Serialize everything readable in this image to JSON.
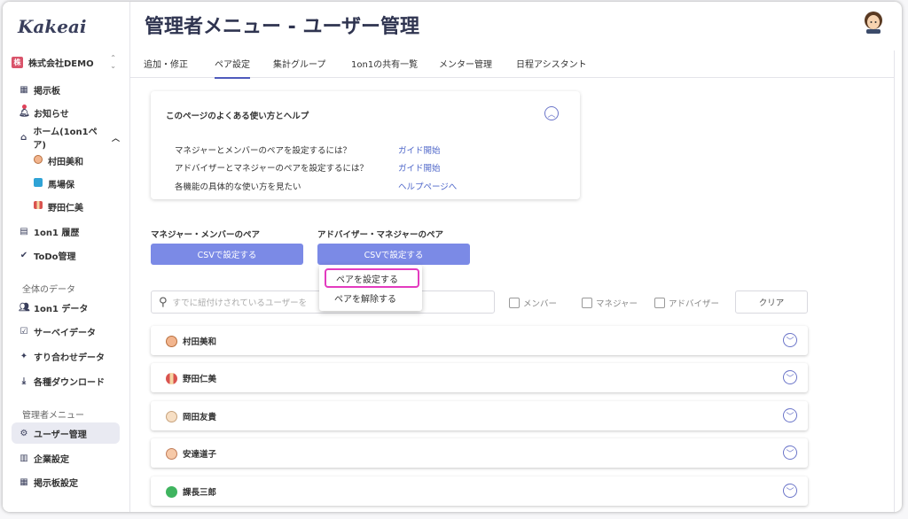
{
  "app": {
    "logo": "Kakeai"
  },
  "sidebar": {
    "company": "株式会社DEMO",
    "company_badge": "株",
    "items": [
      {
        "label": "掲示板",
        "icon": "board-icon"
      },
      {
        "label": "お知らせ",
        "icon": "bell-icon"
      },
      {
        "label": "ホーム(1on1ペア)",
        "icon": "home-icon"
      },
      {
        "label": "村田美和",
        "icon": "avatar"
      },
      {
        "label": "馬場保",
        "icon": "avatar"
      },
      {
        "label": "野田仁美",
        "icon": "avatar"
      },
      {
        "label": "1on1 履歴",
        "icon": "history-icon"
      },
      {
        "label": "ToDo管理",
        "icon": "check-circle-icon"
      }
    ],
    "section_data": "全体のデータ",
    "data_items": [
      {
        "label": "1on1 データ",
        "icon": "people-icon"
      },
      {
        "label": "サーベイデータ",
        "icon": "calendar-check-icon"
      },
      {
        "label": "すり合わせデータ",
        "icon": "handshake-icon"
      },
      {
        "label": "各種ダウンロード",
        "icon": "download-icon"
      }
    ],
    "section_admin": "管理者メニュー",
    "admin_items": [
      {
        "label": "ユーザー管理",
        "icon": "users-gear-icon"
      },
      {
        "label": "企業設定",
        "icon": "building-icon"
      },
      {
        "label": "掲示板設定",
        "icon": "board-settings-icon"
      }
    ]
  },
  "header": {
    "title": "管理者メニュー - ユーザー管理"
  },
  "tabs": [
    {
      "label": "追加・修正"
    },
    {
      "label": "ペア設定"
    },
    {
      "label": "集計グループ"
    },
    {
      "label": "1on1の共有一覧"
    },
    {
      "label": "メンター管理"
    },
    {
      "label": "日程アシスタント"
    }
  ],
  "help": {
    "title": "このページのよくある使い方とヘルプ",
    "rows": [
      {
        "text": "マネジャーとメンバーのペアを設定するには？",
        "link": "ガイド開始"
      },
      {
        "text": "アドバイザーとマネジャーのペアを設定するには？",
        "link": "ガイド開始"
      },
      {
        "text": "各機能の具体的な使い方を見たい",
        "link": "ヘルプページへ"
      }
    ]
  },
  "pairs": {
    "manager_member_label": "マネジャー・メンバーのペア",
    "advisor_manager_label": "アドバイザー・マネジャーのペア",
    "csv_button": "CSVで設定する",
    "dropdown": [
      "ペアを設定する",
      "ペアを解除する"
    ]
  },
  "filters": {
    "search_placeholder": "すでに紐付けされているユーザーを",
    "checks": [
      "メンバー",
      "マネジャー",
      "アドバイザー"
    ],
    "clear": "クリア"
  },
  "users": [
    {
      "name": "村田美和"
    },
    {
      "name": "野田仁美"
    },
    {
      "name": "岡田友貴"
    },
    {
      "name": "安達道子"
    },
    {
      "name": "課長三郎"
    }
  ],
  "colors": {
    "accent": "#7b8ae6",
    "highlight": "#e33bbf",
    "link": "#4f67c9"
  }
}
